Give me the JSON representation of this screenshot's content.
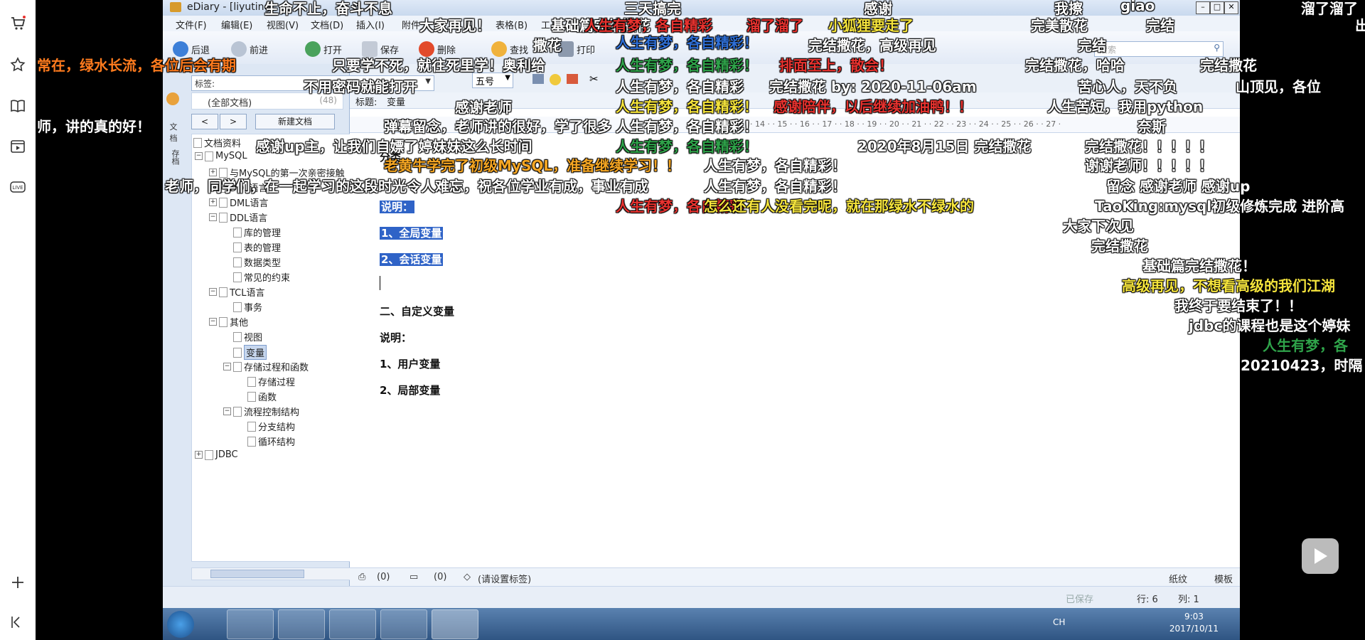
{
  "app": {
    "title": "eDiary - [liyuting",
    "menus": [
      "文件(F)",
      "编辑(E)",
      "视图(V)",
      "文档(D)",
      "插入(I)",
      "附件",
      "表格(B)",
      "工具"
    ],
    "toolbar": [
      "后退",
      "前进",
      "打开",
      "保存",
      "删除",
      "查找",
      "打印"
    ],
    "font_size": "五号",
    "search_placeholder": "搜索"
  },
  "leftpanel": {
    "tag_label": "标签:",
    "all_docs": "(全部文档)",
    "all_docs_count": "(48)",
    "new_doc": "新建文档",
    "vtab1": "文档",
    "vtab2": "存档",
    "tree": [
      "文档资料",
      "MySQL",
      "与MySQL的第一次亲密接触",
      "DQL语言",
      "DML语言",
      "DDL语言",
      "库的管理",
      "表的管理",
      "数据类型",
      "常见的约束",
      "TCL语言",
      "事务",
      "其他",
      "视图",
      "变量",
      "存储过程和函数",
      "存储过程",
      "函数",
      "流程控制结构",
      "分支结构",
      "循环结构",
      "JDBC"
    ]
  },
  "editor": {
    "subject_label": "标题:",
    "subject": "变量",
    "ruler": "· 12 · · 13 · · 14 · · 15 · · 16 · · 17 · · 18 · · 19 · · 20 · · 21 · · 22 · · 23 · · 24 · · 25 · · 26 · · 27 ·",
    "lines": {
      "l0": "分类",
      "l1": "说明：",
      "l2": "1、全局变量",
      "l3": "2、会话变量",
      "l4": "二、自定义变量",
      "l5": "说明：",
      "l6": "1、用户变量",
      "l7": "2、局部变量"
    },
    "bottom": {
      "attach": "(0)",
      "comments": "(0)",
      "tags": "(请设置标签)",
      "paper": "纸纹",
      "template": "模板"
    },
    "status": {
      "saved": "已保存",
      "row": "行: 6",
      "col": "列: 1"
    }
  },
  "taskbar": {
    "lang": "CH",
    "time": "9:03",
    "date": "2017/10/11"
  },
  "danmaku": [
    {
      "t": "生命不止，奋斗不息",
      "c": "#ffffff"
    },
    {
      "t": "三天搞完",
      "c": "#ffffff"
    },
    {
      "t": "感谢",
      "c": "#ffffff"
    },
    {
      "t": "我擦",
      "c": "#ffffff"
    },
    {
      "t": "giao",
      "c": "#ffffff"
    },
    {
      "t": "溜了溜了",
      "c": "#ffffff"
    },
    {
      "t": "大家再见！",
      "c": "#ffffff"
    },
    {
      "t": "基础篇完结撒花",
      "c": "#ffffff"
    },
    {
      "t": "人生有梦，各自精彩",
      "c": "#e8322f"
    },
    {
      "t": "溜了溜了",
      "c": "#e8322f"
    },
    {
      "t": "小狐狸要走了",
      "c": "#f5e43c"
    },
    {
      "t": "完美散花",
      "c": "#ffffff"
    },
    {
      "t": "完结",
      "c": "#ffffff"
    },
    {
      "t": "撒花",
      "c": "#ffffff"
    },
    {
      "t": "人生有梦，各自精彩！",
      "c": "#2f6fd6"
    },
    {
      "t": "完结撒花，高级再见",
      "c": "#ffffff"
    },
    {
      "t": "完结",
      "c": "#ffffff"
    },
    {
      "t": "常在，绿水长流，各位后会有期",
      "c": "#ff7b1e"
    },
    {
      "t": "只要学不死，就往死里学！奥利给",
      "c": "#ffffff"
    },
    {
      "t": "人生有梦，各自精彩！",
      "c": "#2fa34a"
    },
    {
      "t": "排面至上，散会！",
      "c": "#e8322f"
    },
    {
      "t": "完结撒花，哈哈",
      "c": "#ffffff"
    },
    {
      "t": "完结撒花",
      "c": "#ffffff"
    },
    {
      "t": "不用密码就能打开",
      "c": "#ffffff"
    },
    {
      "t": "人生有梦，各自精彩",
      "c": "#ffffff"
    },
    {
      "t": "完结撒花 by: 2020-11-06am",
      "c": "#ffffff"
    },
    {
      "t": "苦心人，天不负",
      "c": "#ffffff"
    },
    {
      "t": "山顶见，各位",
      "c": "#ffffff"
    },
    {
      "t": "师，讲的真的好！",
      "c": "#ffffff"
    },
    {
      "t": "感谢老师",
      "c": "#ffffff"
    },
    {
      "t": "人生有梦，各自精彩！",
      "c": "#f5e43c"
    },
    {
      "t": "感谢陪伴，以后继续加油鸭！！",
      "c": "#e8322f"
    },
    {
      "t": "人生苦短，我用python",
      "c": "#ffffff"
    },
    {
      "t": "弹幕留念，老师讲的很好，学了很多",
      "c": "#ffffff"
    },
    {
      "t": "人生有梦，各自精彩！",
      "c": "#ffffff"
    },
    {
      "t": "奈斯",
      "c": "#ffffff"
    },
    {
      "t": "感谢up主，让我们自嫖了婷妹妹这么长时间",
      "c": "#ffffff"
    },
    {
      "t": "人生有梦，各自精彩！",
      "c": "#2fa34a"
    },
    {
      "t": "2020年8月15日 完结撒花",
      "c": "#ffffff"
    },
    {
      "t": "完结撒花！！！！！",
      "c": "#ffffff"
    },
    {
      "t": "老黄牛学完了初级MySQL，准备继续学习！！",
      "c": "#f5a623"
    },
    {
      "t": "人生有梦，各自精彩！",
      "c": "#ffffff"
    },
    {
      "t": "谢谢老师！！！！！",
      "c": "#ffffff"
    },
    {
      "t": "老师，同学们，在一起学习的这段时光令人难忘，祝各位学业有成，事业有成",
      "c": "#ffffff"
    },
    {
      "t": "人生有梦，各自精彩！",
      "c": "#ffffff"
    },
    {
      "t": "留念 感谢老师 感谢up",
      "c": "#ffffff"
    },
    {
      "t": "人生有梦，各自精彩",
      "c": "#e8322f"
    },
    {
      "t": "怎么还有人没看完呢，就在那绿水不绿水的",
      "c": "#f5e43c"
    },
    {
      "t": "TaoKing:mysql初级修炼完成 进阶高",
      "c": "#ffffff"
    },
    {
      "t": "大家下次见",
      "c": "#ffffff"
    },
    {
      "t": "完结撒花",
      "c": "#ffffff"
    },
    {
      "t": "基础篇完结撒花！",
      "c": "#ffffff"
    },
    {
      "t": "高级再见，不想看高级的我们江湖",
      "c": "#f5e43c"
    },
    {
      "t": "我终于要结束了！！",
      "c": "#ffffff"
    },
    {
      "t": "jdbc的课程也是这个婷妹",
      "c": "#ffffff"
    },
    {
      "t": "人生有梦，各",
      "c": "#2fa34a"
    },
    {
      "t": "20210423，时隔",
      "c": "#ffffff"
    },
    {
      "t": "出",
      "c": "#ffffff"
    }
  ]
}
